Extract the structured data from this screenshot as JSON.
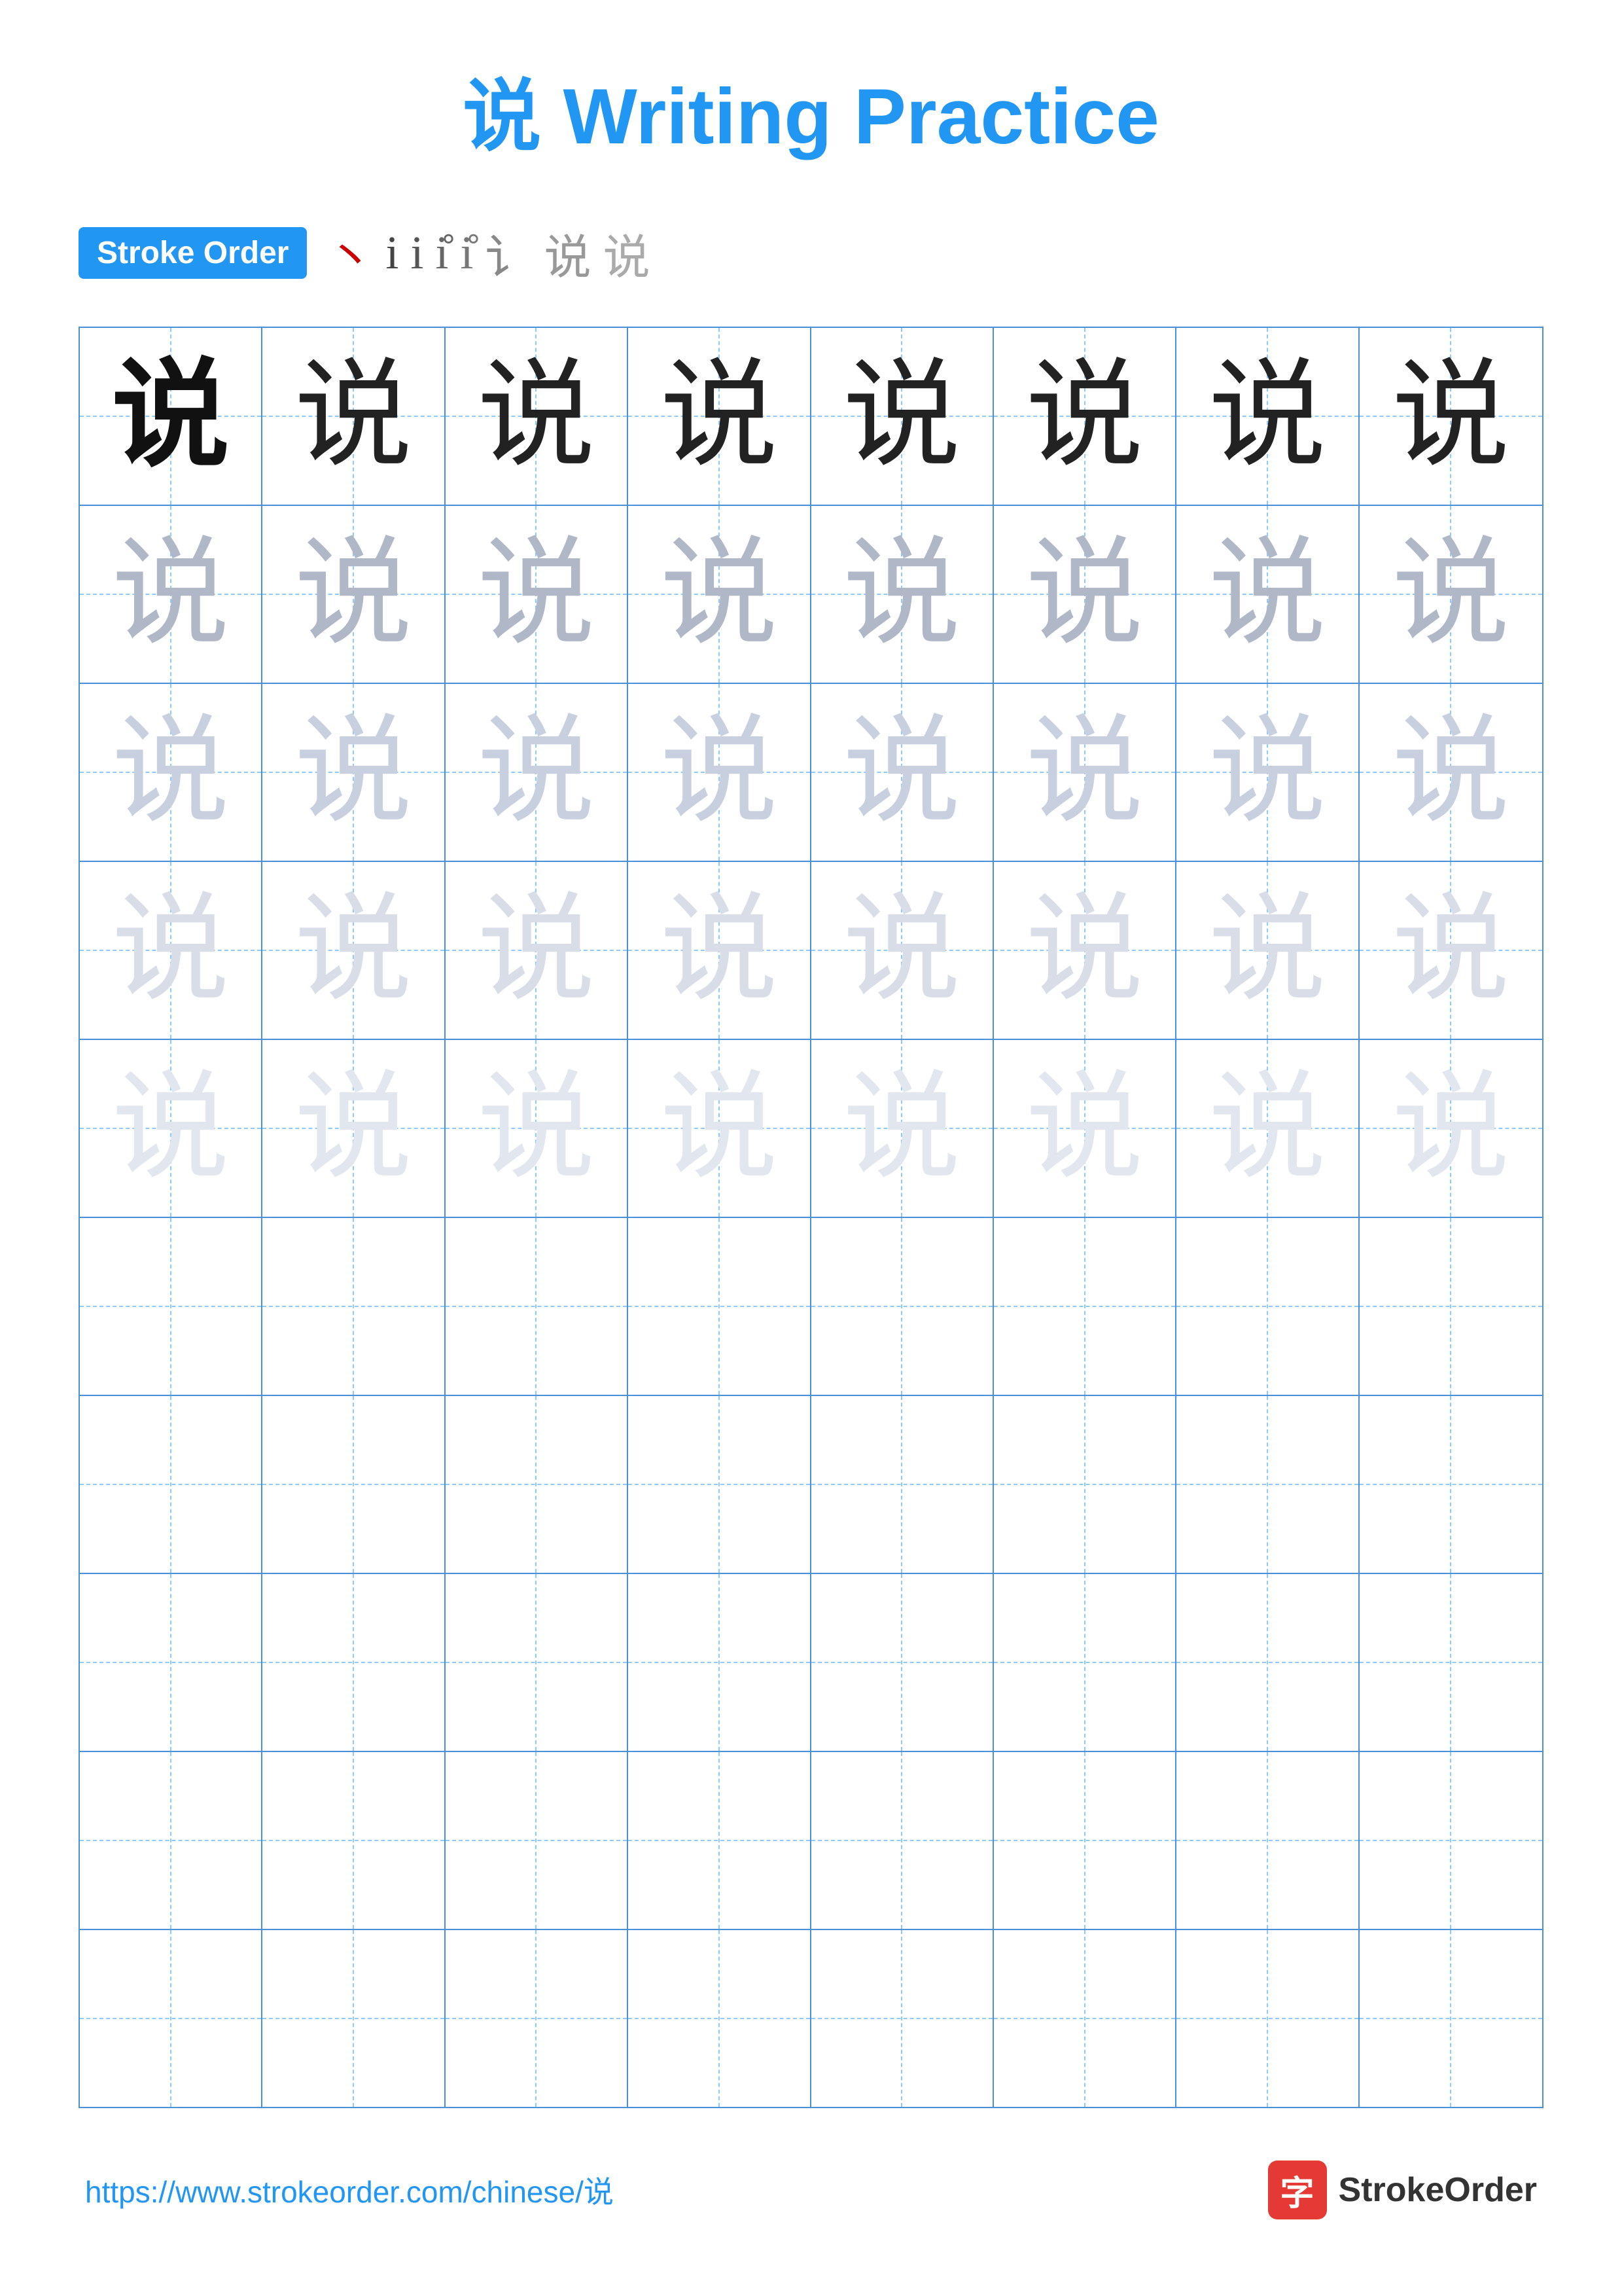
{
  "title": {
    "char": "说",
    "text": " Writing Practice"
  },
  "stroke_order": {
    "badge_label": "Stroke Order",
    "strokes": [
      "丶",
      "i",
      "i",
      "i̊",
      "i̊",
      "讠",
      "讠",
      "说"
    ]
  },
  "character": "说",
  "grid": {
    "rows": 10,
    "cols": 8,
    "practice_rows": 5,
    "empty_rows": 5
  },
  "footer": {
    "url": "https://www.strokeorder.com/chinese/说",
    "brand": "StrokeOrder",
    "brand_char": "字"
  }
}
